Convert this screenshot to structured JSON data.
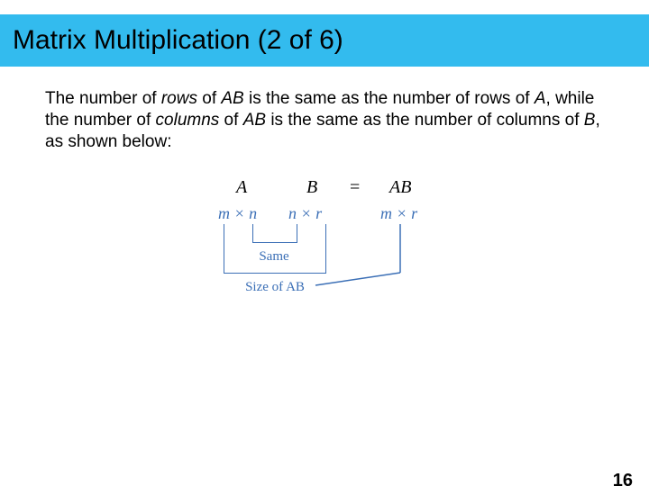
{
  "title": "Matrix Multiplication (2 of 6)",
  "paragraph": {
    "p1": "The number of ",
    "p2": "rows",
    "p3": " of ",
    "p4": "AB",
    "p5": " is the same as the number of rows of ",
    "p6": "A",
    "p7": ", while the number of ",
    "p8": "columns",
    "p9": " of ",
    "p10": "AB",
    "p11": " is the same as the number of columns of ",
    "p12": "B",
    "p13": ", as shown below:"
  },
  "diagram": {
    "A": "A",
    "B": "B",
    "eq": "=",
    "AB": "AB",
    "dimA": "m × n",
    "dimB": "n × r",
    "dimAB": "m × r",
    "same": "Same",
    "sizeAB": "Size of AB"
  },
  "page": "16"
}
